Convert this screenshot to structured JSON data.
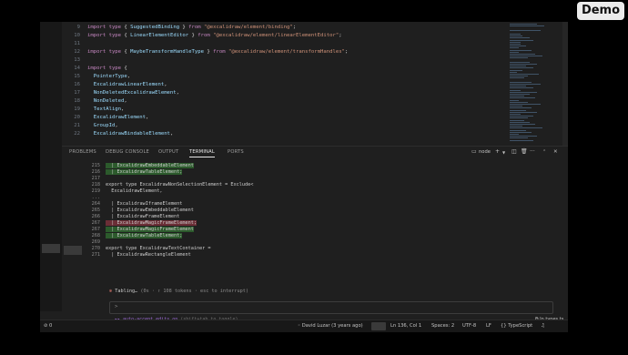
{
  "badge": "Demo",
  "editor": {
    "lines": [
      {
        "n": "9",
        "parts": [
          [
            "kw",
            "import type "
          ],
          [
            "pl",
            "{ "
          ],
          [
            "id",
            "SuggestedBinding"
          ],
          [
            "pl",
            " } "
          ],
          [
            "kw",
            "from "
          ],
          [
            "str",
            "\"@excalidraw/element/binding\""
          ],
          [
            "pl",
            ";"
          ]
        ]
      },
      {
        "n": "10",
        "parts": [
          [
            "kw",
            "import type "
          ],
          [
            "pl",
            "{ "
          ],
          [
            "id",
            "LinearElementEditor"
          ],
          [
            "pl",
            " } "
          ],
          [
            "kw",
            "from "
          ],
          [
            "str",
            "\"@excalidraw/element/linearElementEditor\""
          ],
          [
            "pl",
            ";"
          ]
        ]
      },
      {
        "n": "11",
        "parts": []
      },
      {
        "n": "12",
        "parts": [
          [
            "kw",
            "import type "
          ],
          [
            "pl",
            "{ "
          ],
          [
            "id",
            "MaybeTransformHandleType"
          ],
          [
            "pl",
            " } "
          ],
          [
            "kw",
            "from "
          ],
          [
            "str",
            "\"@excalidraw/element/transformHandles\""
          ],
          [
            "pl",
            ";"
          ]
        ]
      },
      {
        "n": "13",
        "parts": []
      },
      {
        "n": "14",
        "parts": [
          [
            "kw",
            "import type "
          ],
          [
            "pl",
            "{"
          ]
        ]
      },
      {
        "n": "15",
        "parts": [
          [
            "id",
            "  PointerType"
          ],
          [
            "pl",
            ","
          ]
        ]
      },
      {
        "n": "16",
        "parts": [
          [
            "id",
            "  ExcalidrawLinearElement"
          ],
          [
            "pl",
            ","
          ]
        ]
      },
      {
        "n": "17",
        "parts": [
          [
            "id",
            "  NonDeletedExcalidrawElement"
          ],
          [
            "pl",
            ","
          ]
        ]
      },
      {
        "n": "18",
        "parts": [
          [
            "id",
            "  NonDeleted"
          ],
          [
            "pl",
            ","
          ]
        ]
      },
      {
        "n": "19",
        "parts": [
          [
            "id",
            "  TextAlign"
          ],
          [
            "pl",
            ","
          ]
        ]
      },
      {
        "n": "20",
        "parts": [
          [
            "id",
            "  ExcalidrawElement"
          ],
          [
            "pl",
            ","
          ]
        ]
      },
      {
        "n": "21",
        "parts": [
          [
            "id",
            "  GroupId"
          ],
          [
            "pl",
            ","
          ]
        ]
      },
      {
        "n": "22",
        "parts": [
          [
            "id",
            "  ExcalidrawBindableElement"
          ],
          [
            "pl",
            ","
          ]
        ]
      }
    ]
  },
  "panel": {
    "tabs": [
      "PROBLEMS",
      "DEBUG CONSOLE",
      "OUTPUT",
      "TERMINAL",
      "PORTS"
    ],
    "active_tab": "TERMINAL",
    "terminal_name": "node",
    "plus": "+",
    "more": "···",
    "close": "✕",
    "terminal_lines": [
      {
        "n": "215",
        "t": "  | ExcalidrawEmbeddableElement",
        "hl": "g"
      },
      {
        "n": "216",
        "t": "  | ExcalidrawTableElement;",
        "hl": "g"
      },
      {
        "n": "217",
        "t": "",
        "hl": ""
      },
      {
        "n": "218",
        "t": "export type ExcalidrawNonSelectionElement = Exclude<",
        "hl": ""
      },
      {
        "n": "219",
        "t": "  ExcalidrawElement,",
        "hl": ""
      },
      {
        "n": "...",
        "t": "",
        "hl": ""
      },
      {
        "n": "264",
        "t": "  | ExcalidrawIframeElement",
        "hl": ""
      },
      {
        "n": "265",
        "t": "  | ExcalidrawEmbeddableElement",
        "hl": ""
      },
      {
        "n": "266",
        "t": "  | ExcalidrawFrameElement",
        "hl": ""
      },
      {
        "n": "267",
        "t": "  | ExcalidrawMagicFrameElement;",
        "hl": "r"
      },
      {
        "n": "267",
        "t": "  | ExcalidrawMagicFrameElement",
        "hl": "g"
      },
      {
        "n": "268",
        "t": "  | ExcalidrawTableElement;",
        "hl": "g"
      },
      {
        "n": "269",
        "t": "",
        "hl": ""
      },
      {
        "n": "270",
        "t": "export type ExcalidrawTextContainer =",
        "hl": ""
      },
      {
        "n": "271",
        "t": "  | ExcalidrawRectangleElement",
        "hl": ""
      }
    ],
    "spinner": {
      "star": "✻",
      "text": " Tabling… ",
      "meta": "(0s · ↑ 108 tokens · esc to interrupt)"
    },
    "input_prompt": ">",
    "accept": {
      "icon": "▸▸",
      "label": " auto-accept edits on ",
      "hint": "(shift+tab to toggle)"
    },
    "in_file": "⧉ In types.ts"
  },
  "status": {
    "errors": "⊘ 0",
    "blame": "◦ David Luzar (3 years ago)",
    "position": "Ln 136, Col 1",
    "spaces": "Spaces: 2",
    "encoding": "UTF-8",
    "eol": "LF",
    "language": "{} TypeScript",
    "bell": "♫"
  }
}
